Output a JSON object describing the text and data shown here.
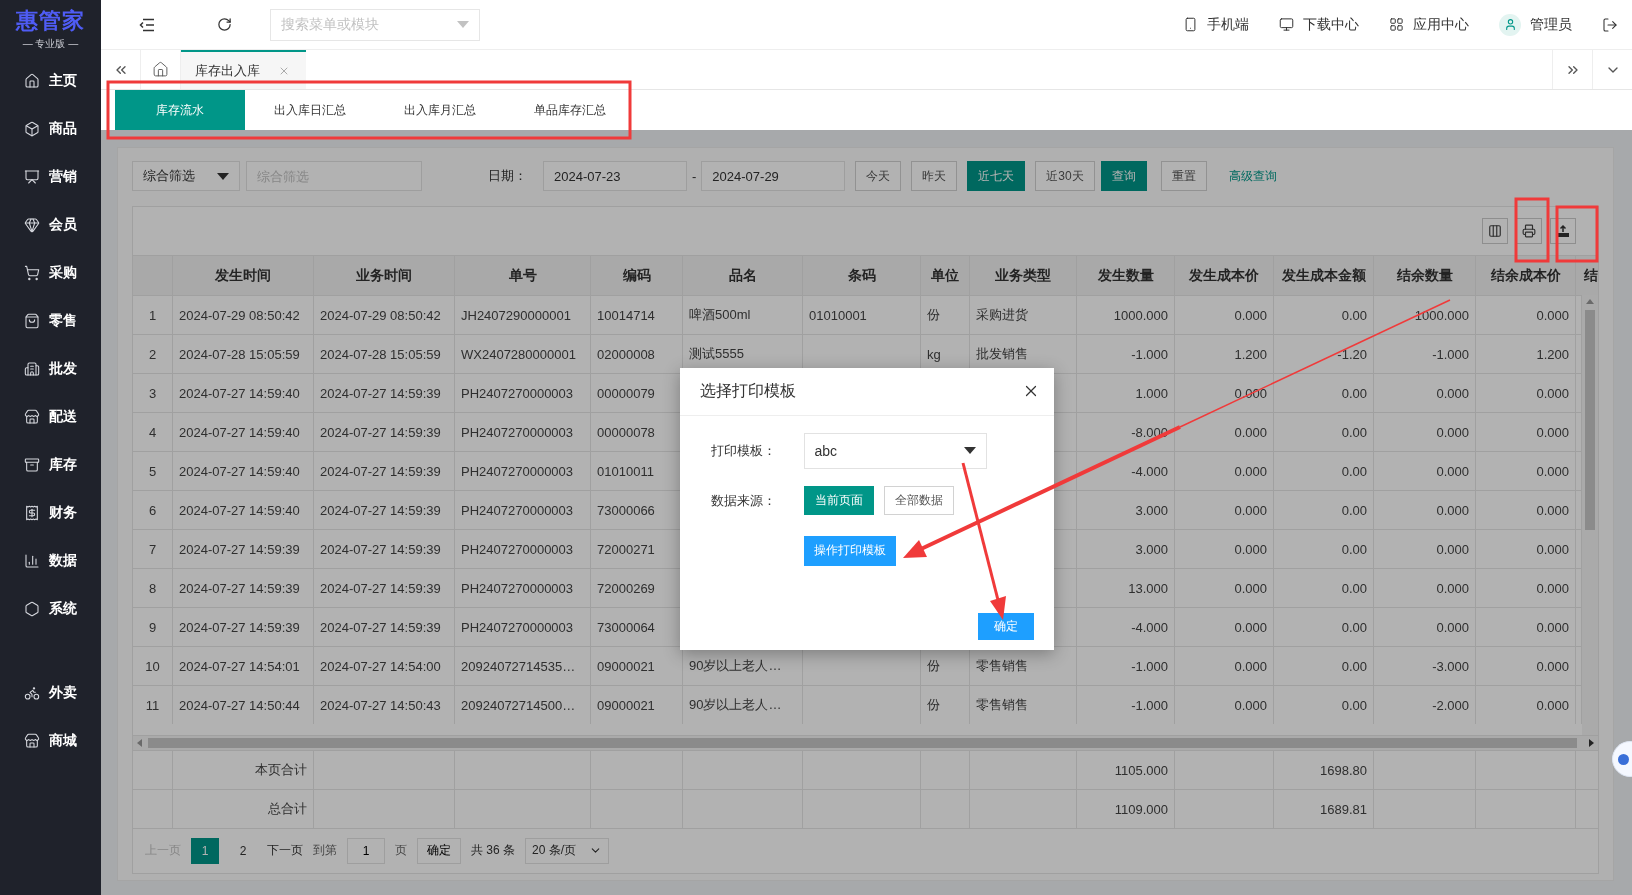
{
  "sidebar": {
    "logo": "惠管家",
    "edition": "— 专业版 —",
    "items": [
      {
        "label": "主页"
      },
      {
        "label": "商品"
      },
      {
        "label": "营销"
      },
      {
        "label": "会员"
      },
      {
        "label": "采购"
      },
      {
        "label": "零售"
      },
      {
        "label": "批发"
      },
      {
        "label": "配送"
      },
      {
        "label": "库存"
      },
      {
        "label": "财务"
      },
      {
        "label": "数据"
      },
      {
        "label": "系统"
      }
    ],
    "apps": [
      {
        "label": "外卖"
      },
      {
        "label": "商城"
      }
    ]
  },
  "header": {
    "search_placeholder": "搜索菜单或模块",
    "links": [
      "手机端",
      "下载中心",
      "应用中心"
    ],
    "user": "管理员"
  },
  "tabs": [
    {
      "label": "库存出入库",
      "selected": true
    }
  ],
  "subtabs": [
    {
      "label": "库存流水",
      "selected": true
    },
    {
      "label": "出入库日汇总",
      "selected": false
    },
    {
      "label": "出入库月汇总",
      "selected": false
    },
    {
      "label": "单品库存汇总",
      "selected": false
    }
  ],
  "filter": {
    "mode": "综合筛选",
    "keyword_placeholder": "综合筛选",
    "date_label": "日期：",
    "date_from": "2024-07-23",
    "separator": "-",
    "date_to": "2024-07-29",
    "presets": [
      {
        "label": "今天",
        "selected": false
      },
      {
        "label": "昨天",
        "selected": false
      },
      {
        "label": "近七天",
        "selected": true
      },
      {
        "label": "近30天",
        "selected": false
      }
    ],
    "query": "查询",
    "reset": "重置",
    "advanced": "高级查询"
  },
  "table": {
    "columns": [
      "发生时间",
      "业务时间",
      "单号",
      "编码",
      "品名",
      "条码",
      "单位",
      "业务类型",
      "发生数量",
      "发生成本价",
      "发生成本金额",
      "结余数量",
      "结余成本价",
      "结"
    ],
    "rows": [
      {
        "index": "1",
        "cells": [
          "2024-07-29 08:50:42",
          "2024-07-29 08:50:42",
          "JH2407290000001",
          "10014714",
          "啤酒500ml",
          "01010001",
          "份",
          "采购进货",
          "1000.000",
          "0.000",
          "0.00",
          "1000.000",
          "0.000"
        ]
      },
      {
        "index": "2",
        "cells": [
          "2024-07-28 15:05:59",
          "2024-07-28 15:05:59",
          "WX2407280000001",
          "02000008",
          "测试5555",
          null,
          "kg",
          "批发销售",
          "-1.000",
          "1.200",
          "-1.20",
          "-1.000",
          "1.200"
        ]
      },
      {
        "index": "3",
        "cells": [
          "2024-07-27 14:59:40",
          "2024-07-27 14:59:39",
          "PH2407270000003",
          "00000079",
          null,
          null,
          null,
          null,
          "1.000",
          "0.000",
          "0.00",
          "0.000",
          "0.000"
        ]
      },
      {
        "index": "4",
        "cells": [
          "2024-07-27 14:59:40",
          "2024-07-27 14:59:39",
          "PH2407270000003",
          "00000078",
          null,
          null,
          null,
          null,
          "-8.000",
          "0.000",
          "0.00",
          "0.000",
          "0.000"
        ]
      },
      {
        "index": "5",
        "cells": [
          "2024-07-27 14:59:40",
          "2024-07-27 14:59:39",
          "PH2407270000003",
          "01010011",
          null,
          null,
          null,
          null,
          "-4.000",
          "0.000",
          "0.00",
          "0.000",
          "0.000"
        ]
      },
      {
        "index": "6",
        "cells": [
          "2024-07-27 14:59:40",
          "2024-07-27 14:59:39",
          "PH2407270000003",
          "73000066",
          null,
          null,
          null,
          null,
          "3.000",
          "0.000",
          "0.00",
          "0.000",
          "0.000"
        ]
      },
      {
        "index": "7",
        "cells": [
          "2024-07-27 14:59:39",
          "2024-07-27 14:59:39",
          "PH2407270000003",
          "72000271",
          null,
          null,
          null,
          null,
          "3.000",
          "0.000",
          "0.00",
          "0.000",
          "0.000"
        ]
      },
      {
        "index": "8",
        "cells": [
          "2024-07-27 14:59:39",
          "2024-07-27 14:59:39",
          "PH2407270000003",
          "72000269",
          null,
          null,
          null,
          null,
          "13.000",
          "0.000",
          "0.00",
          "0.000",
          "0.000"
        ]
      },
      {
        "index": "9",
        "cells": [
          "2024-07-27 14:59:39",
          "2024-07-27 14:59:39",
          "PH2407270000003",
          "73000064",
          null,
          null,
          null,
          null,
          "-4.000",
          "0.000",
          "0.00",
          "0.000",
          "0.000"
        ]
      },
      {
        "index": "10",
        "cells": [
          "2024-07-27 14:54:01",
          "2024-07-27 14:54:00",
          "20924072714535…",
          "09000021",
          "90岁以上老人…",
          null,
          "份",
          "零售销售",
          "-1.000",
          "0.000",
          "0.00",
          "-3.000",
          "0.000"
        ]
      },
      {
        "index": "11",
        "cells": [
          "2024-07-27 14:50:44",
          "2024-07-27 14:50:43",
          "20924072714500…",
          "09000021",
          "90岁以上老人…",
          null,
          "份",
          "零售销售",
          "-1.000",
          "0.000",
          "0.00",
          "-2.000",
          "0.000"
        ]
      }
    ],
    "totals": [
      {
        "label": "本页合计",
        "quantity": "1105.000",
        "amount": "1698.80"
      },
      {
        "label": "总合计",
        "quantity": "1109.000",
        "amount": "1689.81"
      }
    ]
  },
  "pagination": {
    "prev": "上一页",
    "prev_disabled": true,
    "pages": [
      {
        "label": "1",
        "selected": true
      },
      {
        "label": "2",
        "selected": false
      }
    ],
    "next": "下一页",
    "goto_label": "到第",
    "goto_value": "1",
    "page_unit": "页",
    "confirm": "确定",
    "total": "共 36 条",
    "page_size": "20 条/页"
  },
  "modal": {
    "title": "选择打印模板",
    "template_label": "打印模板：",
    "template_value": "abc",
    "source_label": "数据来源：",
    "sources": [
      {
        "label": "当前页面",
        "selected": true
      },
      {
        "label": "全部数据",
        "selected": false
      }
    ],
    "edit_button": "操作打印模板",
    "ok_button": "确定"
  }
}
